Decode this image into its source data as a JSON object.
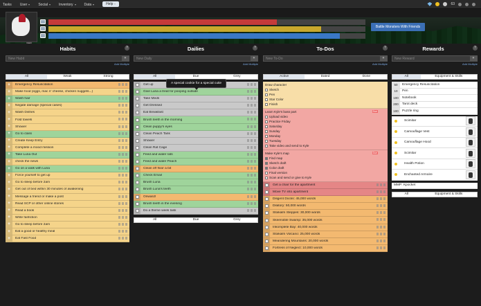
{
  "menu": {
    "tasks": "Tasks",
    "user": "User",
    "social": "Social",
    "inventory": "Inventory",
    "data": "Data",
    "help": "Help"
  },
  "status": {
    "gems": "",
    "gold": "",
    "silver": "63"
  },
  "header": {
    "level": "11",
    "battle": "Battle Monsters With Friends"
  },
  "stats": {
    "hp": 0.72,
    "xp": 0.86,
    "mp": 0.92
  },
  "columns": {
    "habits": "Habits",
    "dailies": "Dailies",
    "todos": "To-Dos",
    "rewards": "Rewards"
  },
  "placeholders": {
    "habit": "New Habit",
    "daily": "New Daily",
    "todo": "New To-Do",
    "reward": "New Reward"
  },
  "add_multiple": "Add Multiple",
  "habit_tabs": [
    "All",
    "Weak",
    "Strong"
  ],
  "daily_tabs": [
    "All",
    "Due",
    "Grey"
  ],
  "todo_tabs": [
    "Active",
    "Dated",
    "Done"
  ],
  "reward_tabs": [
    "All",
    "Equipment & Skills"
  ],
  "tooltip": "A special cookie for a special cutie",
  "habits": [
    {
      "t": "Emergency Resuscitation",
      "c": "c-or"
    },
    {
      "t": "Make food (eggs, mac n' cheese, chicken nuggets...)",
      "c": "c-yel"
    },
    {
      "t": "Wash hair",
      "c": "c-grn"
    },
    {
      "t": "Negate damage (special cases)",
      "c": "c-yel"
    },
    {
      "t": "Wash Dishes",
      "c": "c-yel"
    },
    {
      "t": "Fold towels",
      "c": "c-yel"
    },
    {
      "t": "Shower",
      "c": "c-yel"
    },
    {
      "t": "Go to class",
      "c": "c-grn"
    },
    {
      "t": "Create Keep Entry",
      "c": "c-yel"
    },
    {
      "t": "Complete a mood mission",
      "c": "c-yel"
    },
    {
      "t": "Take Luna Out",
      "c": "c-grn"
    },
    {
      "t": "check the news",
      "c": "c-yel"
    },
    {
      "t": "Go on a walk with Luna",
      "c": "c-grn"
    },
    {
      "t": "Force yourself to get up",
      "c": "c-yel"
    },
    {
      "t": "Go to sleep before 2am",
      "c": "c-yel"
    },
    {
      "t": "Get out of bed within 30 minutes of awakening",
      "c": "c-yel"
    },
    {
      "t": "Message a friend or make a post",
      "c": "c-yel"
    },
    {
      "t": "Read SCP or other online stories",
      "c": "c-yel"
    },
    {
      "t": "Read a book",
      "c": "c-yel"
    },
    {
      "t": "Write fanfiction",
      "c": "c-yel"
    },
    {
      "t": "Go to sleep before 2am",
      "c": "c-yel"
    },
    {
      "t": "Eat a good or healthy meal",
      "c": "c-yel"
    },
    {
      "t": "Eat Fast Food",
      "c": "c-yel"
    }
  ],
  "dailies": [
    {
      "t": "Get up",
      "c": "c-gry"
    },
    {
      "t": "Give Luna a treat for pooping outside",
      "c": "c-grn"
    },
    {
      "t": "Take Meds",
      "c": "c-gry"
    },
    {
      "t": "Get Dressed",
      "c": "c-gry"
    },
    {
      "t": "Eat Breakfast",
      "c": "c-gry"
    },
    {
      "t": "Brush teeth in the morning",
      "c": "c-grn"
    },
    {
      "t": "Clean puppy's eyes",
      "c": "c-grn"
    },
    {
      "t": "Clean Peach Tank",
      "c": "c-gry"
    },
    {
      "t": "Shower",
      "c": "c-gry"
    },
    {
      "t": "Clean Rat Cage",
      "c": "c-gry"
    },
    {
      "t": "Feed and water rats",
      "c": "c-grn"
    },
    {
      "t": "Feed and water Peach",
      "c": "c-grn"
    },
    {
      "t": "Clean off floor a bit",
      "c": "c-or"
    },
    {
      "t": "Check Email",
      "c": "c-grn"
    },
    {
      "t": "Brush Luna",
      "c": "c-grn"
    },
    {
      "t": "Brush Luna's teeth",
      "c": "c-grn"
    },
    {
      "t": "Onward!",
      "c": "c-or"
    },
    {
      "t": "Brush teeth in the evening",
      "c": "c-grn"
    },
    {
      "t": "Do a theme week task",
      "c": "c-gry"
    }
  ],
  "todo_groups": [
    {
      "title": "Draw character",
      "c": "c-lor",
      "items": [
        {
          "t": "Sketch",
          "on": false
        },
        {
          "t": "Pen",
          "on": false
        },
        {
          "t": "Star Color",
          "on": false
        },
        {
          "t": "Finish",
          "on": false
        }
      ]
    },
    {
      "title": "Learn Kyle's bass part",
      "c": "c-red",
      "badge": "Due",
      "items": [
        {
          "t": "Upload video",
          "on": false
        },
        {
          "t": "Practice Friday",
          "on": false
        },
        {
          "t": "Saturday",
          "on": false
        },
        {
          "t": "Sunday",
          "on": false
        },
        {
          "t": "Monday",
          "on": false
        },
        {
          "t": "Tuesday",
          "on": false
        },
        {
          "t": "Take video and send to Kyle",
          "on": false
        }
      ]
    },
    {
      "title": "Make Kyle's map",
      "c": "c-red",
      "badge": "Due",
      "items": [
        {
          "t": "Find map",
          "on": true
        },
        {
          "t": "Sketch draft",
          "on": true
        },
        {
          "t": "Color draft",
          "on": true
        },
        {
          "t": "Final version",
          "on": false
        },
        {
          "t": "Scan and send or give to Kyle",
          "on": false
        }
      ]
    }
  ],
  "todos": [
    {
      "t": "Get a chair for the apartment",
      "c": "c-dred"
    },
    {
      "t": "Move TV into apartment",
      "c": "c-dred"
    },
    {
      "t": "Diligent Docks: 45,000 words",
      "c": "c-or"
    },
    {
      "t": "Dilatory: 50,000 words",
      "c": "c-or"
    },
    {
      "t": "Stoikalm Steppes: 30,000 words",
      "c": "c-or"
    },
    {
      "t": "Skeenoble Swamp: 35,000 words",
      "c": "c-or"
    },
    {
      "t": "Inkomplete Bay: 40,000 words",
      "c": "c-or"
    },
    {
      "t": "Stoikalm Volcano: 25,000 words",
      "c": "c-or"
    },
    {
      "t": "Meandering Mountains: 20,000 words",
      "c": "c-or"
    },
    {
      "t": "Fortress of Neglect: 10,000 words",
      "c": "c-or"
    }
  ],
  "rewards": [
    {
      "p": "50",
      "t": "Emergency Resuscitation"
    },
    {
      "p": "10",
      "t": "Pen"
    },
    {
      "p": "100",
      "t": "Notebook"
    },
    {
      "p": "200",
      "t": "Tarot deck"
    },
    {
      "p": "100",
      "t": "Puzzle ring"
    }
  ],
  "gear": [
    {
      "p": "",
      "t": "Scimitar"
    },
    {
      "p": "",
      "t": "Camouflage Vest"
    },
    {
      "p": "",
      "t": "Camouflage Hood"
    },
    {
      "p": "",
      "t": "Scimitar"
    },
    {
      "p": "",
      "t": "Health Potion"
    },
    {
      "p": "",
      "t": "Enchanted Armoire"
    }
  ],
  "bottom_reward": "MMP: Kpocket",
  "colors": {
    "hp": "#c53a3a",
    "xp": "#c9a82c",
    "mp": "#3a78c5",
    "accent": "#3b6fb5"
  }
}
